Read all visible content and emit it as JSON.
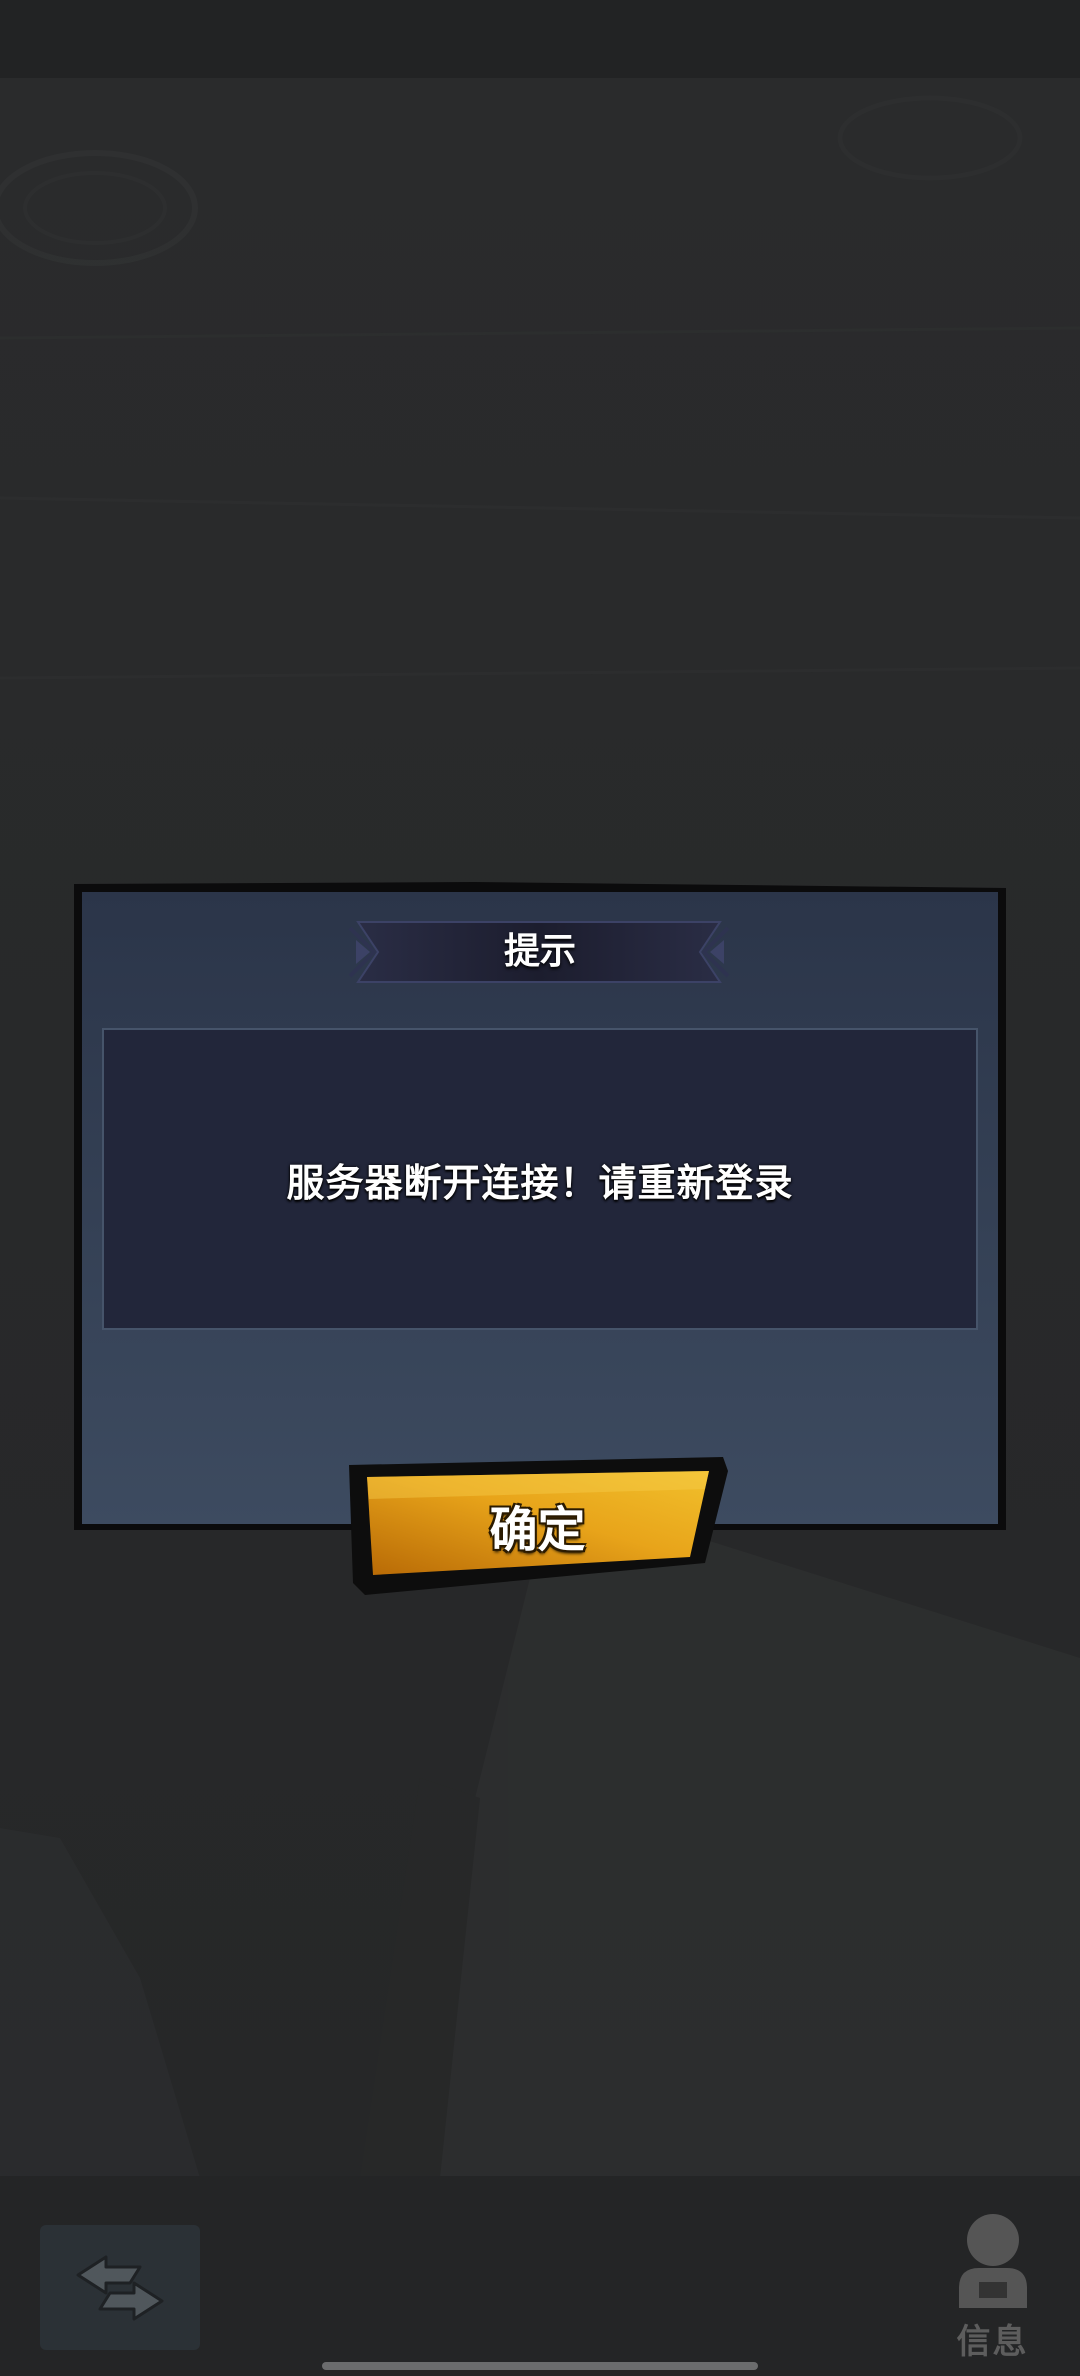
{
  "dialog": {
    "title": "提示",
    "message": "服务器断开连接！请重新登录",
    "confirm_label": "确定"
  },
  "bottom_bar": {
    "info_label": "信息",
    "back_icon": "return-arrow-icon",
    "info_icon": "user-icon"
  },
  "colors": {
    "dialog_bg_top": "#2b3549",
    "dialog_bg_bottom": "#3d4b60",
    "message_bg": "#22263a",
    "button_orange": "#e8a41a",
    "button_dark": "#b86a06"
  }
}
